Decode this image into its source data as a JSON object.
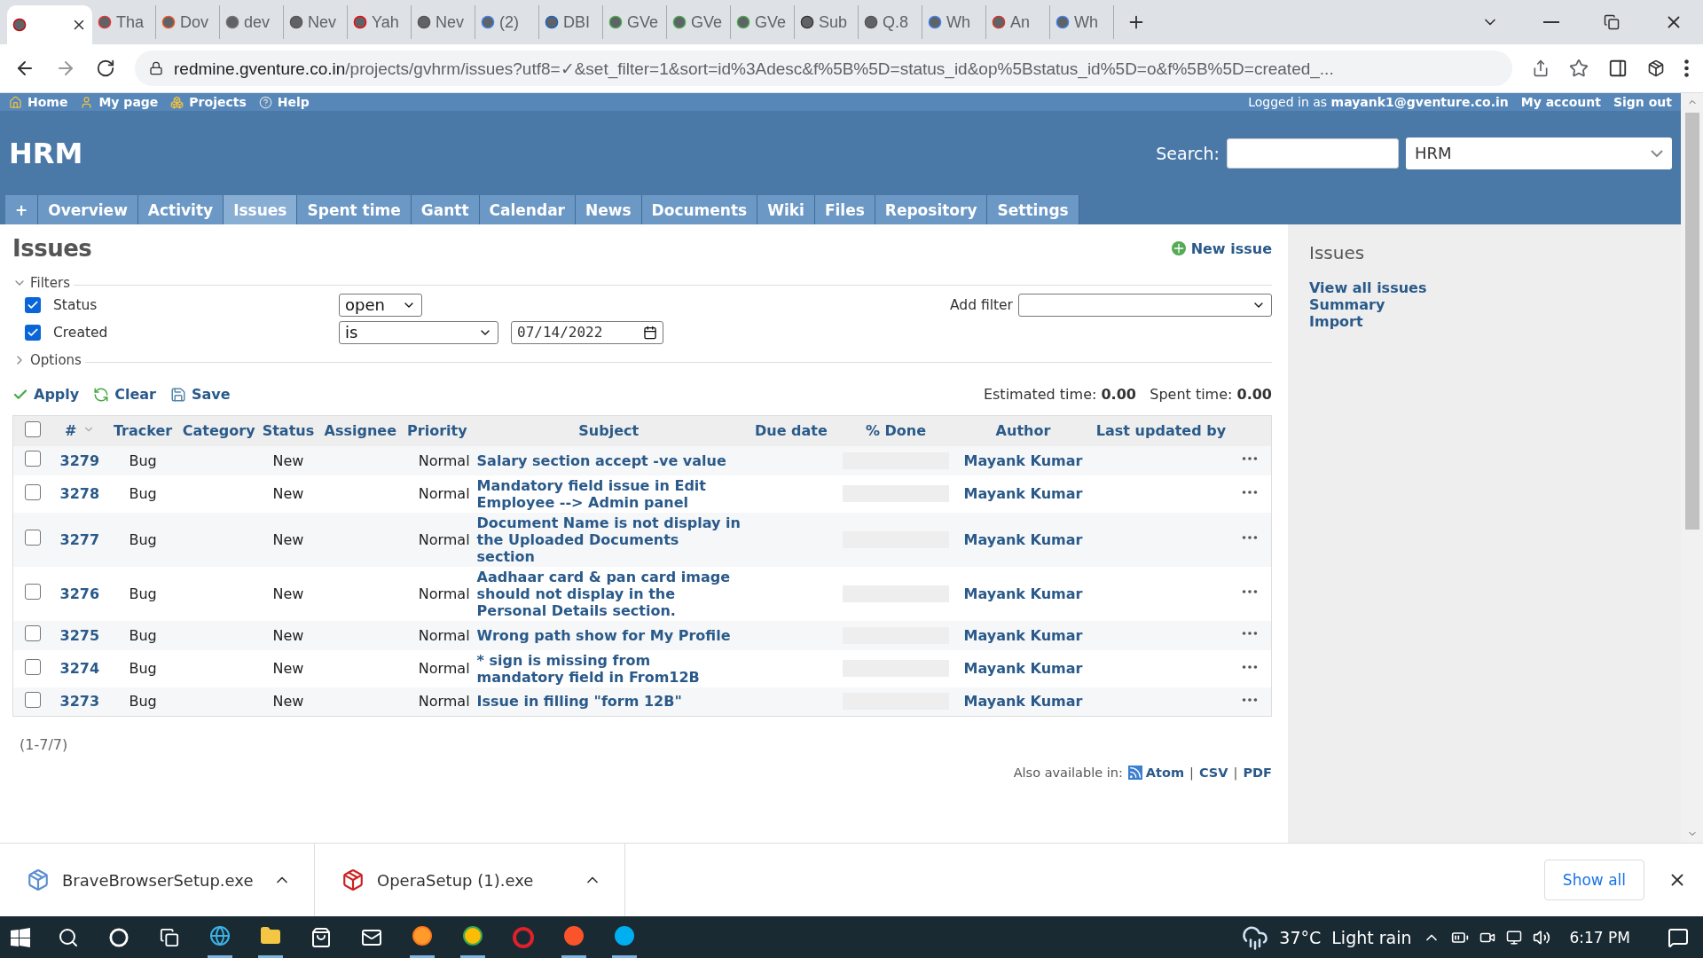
{
  "browser": {
    "tabs": [
      {
        "selected": true
      },
      {
        "title": "Tha",
        "selected": false
      },
      {
        "title": "Dov",
        "selected": false
      },
      {
        "title": "dev",
        "selected": false
      },
      {
        "title": "Nev",
        "selected": false
      },
      {
        "title": "Yah",
        "selected": false
      },
      {
        "title": "Nev",
        "selected": false
      },
      {
        "title": "(2)",
        "selected": false
      },
      {
        "title": "DBI",
        "selected": false
      },
      {
        "title": "GVe",
        "selected": false
      },
      {
        "title": "GVe",
        "selected": false
      },
      {
        "title": "GVe",
        "selected": false
      },
      {
        "title": "Sub",
        "selected": false
      },
      {
        "title": "Q.8",
        "selected": false
      },
      {
        "title": "Wh",
        "selected": false
      },
      {
        "title": "An",
        "selected": false
      },
      {
        "title": "Wh",
        "selected": false
      }
    ],
    "url_host": "redmine.gventure.co.in",
    "url_rest": "/projects/gvhrm/issues?utf8=✓&set_filter=1&sort=id%3Adesc&f%5B%5D=status_id&op%5Bstatus_id%5D=o&f%5B%5D=created_..."
  },
  "top_menu": {
    "left": [
      "Home",
      "My page",
      "Projects",
      "Help"
    ],
    "logged_in_prefix": "Logged in as",
    "user": "mayank1@gventure.co.in",
    "right": [
      "My account",
      "Sign out"
    ]
  },
  "header": {
    "title": "HRM",
    "search_label": "Search:",
    "project_select": "HRM"
  },
  "main_menu": {
    "new_item": "+",
    "items": [
      {
        "label": "Overview",
        "selected": false
      },
      {
        "label": "Activity",
        "selected": false
      },
      {
        "label": "Issues",
        "selected": true
      },
      {
        "label": "Spent time",
        "selected": false
      },
      {
        "label": "Gantt",
        "selected": false
      },
      {
        "label": "Calendar",
        "selected": false
      },
      {
        "label": "News",
        "selected": false
      },
      {
        "label": "Documents",
        "selected": false
      },
      {
        "label": "Wiki",
        "selected": false
      },
      {
        "label": "Files",
        "selected": false
      },
      {
        "label": "Repository",
        "selected": false
      },
      {
        "label": "Settings",
        "selected": false
      }
    ]
  },
  "content": {
    "title": "Issues",
    "new_issue": "New issue",
    "filters_legend": "Filters",
    "filters_expanded": true,
    "filters": [
      {
        "label": "Status",
        "checked": true,
        "operator": "open"
      },
      {
        "label": "Created",
        "checked": true,
        "operator": "is",
        "value": "07/14/2022"
      }
    ],
    "add_filter_label": "Add filter",
    "options_legend": "Options",
    "options_expanded": false,
    "actions": [
      "Apply",
      "Clear",
      "Save"
    ],
    "estimated_label": "Estimated time:",
    "estimated_value": "0.00",
    "spent_label": "Spent time:",
    "spent_value": "0.00",
    "table": {
      "select_all_checked": false,
      "columns": [
        "#",
        "Tracker",
        "Category",
        "Status",
        "Assignee",
        "Priority",
        "Subject",
        "Due date",
        "% Done",
        "Author",
        "Last updated by"
      ],
      "rows": [
        {
          "id": "3279",
          "tracker": "Bug",
          "status": "New",
          "priority": "Normal",
          "subject": "Salary section accept -ve value",
          "done": {
            "level": 0
          },
          "author": "Mayank Kumar",
          "selected": false
        },
        {
          "id": "3278",
          "tracker": "Bug",
          "status": "New",
          "priority": "Normal",
          "subject": "Mandatory field issue in Edit Employee --> Admin panel",
          "done": {
            "level": 0
          },
          "author": "Mayank Kumar",
          "selected": false
        },
        {
          "id": "3277",
          "tracker": "Bug",
          "status": "New",
          "priority": "Normal",
          "subject": "Document Name is not display in the Uploaded Documents section",
          "done": {
            "level": 0
          },
          "author": "Mayank Kumar",
          "selected": false
        },
        {
          "id": "3276",
          "tracker": "Bug",
          "status": "New",
          "priority": "Normal",
          "subject": "Aadhaar card & pan card image should not display in the Personal Details section.",
          "done": {
            "level": 0
          },
          "author": "Mayank Kumar",
          "selected": false
        },
        {
          "id": "3275",
          "tracker": "Bug",
          "status": "New",
          "priority": "Normal",
          "subject": "Wrong path show for My Profile",
          "done": {
            "level": 0
          },
          "author": "Mayank Kumar",
          "selected": false
        },
        {
          "id": "3274",
          "tracker": "Bug",
          "status": "New",
          "priority": "Normal",
          "subject": "* sign is missing from mandatory field in From12B",
          "done": {
            "level": 0
          },
          "author": "Mayank Kumar",
          "selected": false
        },
        {
          "id": "3273",
          "tracker": "Bug",
          "status": "New",
          "priority": "Normal",
          "subject": "Issue in filling \"form 12B\"",
          "done": {
            "level": 0
          },
          "author": "Mayank Kumar",
          "selected": false
        }
      ]
    },
    "pagination": "(1-7/7)",
    "also_label": "Also available in:",
    "formats": [
      "Atom",
      "CSV",
      "PDF"
    ],
    "format_separator": "|"
  },
  "sidebar": {
    "title": "Issues",
    "links": [
      "View all issues",
      "Summary",
      "Import"
    ]
  },
  "downloads": {
    "items": [
      "BraveBrowserSetup.exe",
      "OperaSetup (1).exe"
    ],
    "show_all": "Show all"
  },
  "taskbar": {
    "temperature": "37°C",
    "weather": "Light rain",
    "time": "6:17 PM"
  }
}
